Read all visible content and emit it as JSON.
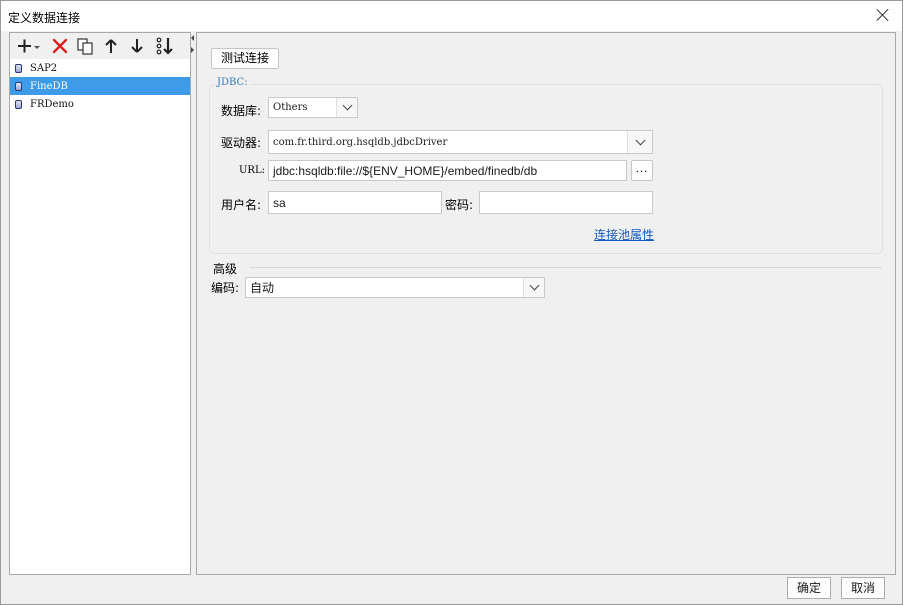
{
  "window": {
    "title": "定义数据连接"
  },
  "toolbar": {
    "add_icon": "plus-with-dropdown-icon",
    "delete_icon": "red-x-icon",
    "copy_icon": "copy-icon",
    "move_up_icon": "arrow-up-icon",
    "move_down_icon": "arrow-down-icon",
    "sort_icon": "sort-icon"
  },
  "connections": [
    {
      "label": "SAP2",
      "selected": false
    },
    {
      "label": "FineDB",
      "selected": true
    },
    {
      "label": "FRDemo",
      "selected": false
    }
  ],
  "detail": {
    "test_button": "测试连接",
    "group_title": "JDBC:",
    "database_label": "数据库:",
    "database_value": "Others",
    "driver_label": "驱动器:",
    "driver_value": "com.fr.third.org.hsqldb.jdbcDriver",
    "url_label": "URL:",
    "url_value": "jdbc:hsqldb:file://${ENV_HOME}/embed/finedb/db",
    "url_browse": "...",
    "username_label": "用户名:",
    "username_value": "sa",
    "password_label": "密码:",
    "password_value": "",
    "pool_link": "连接池属性",
    "advanced_title": "高级",
    "encoding_label": "编码:",
    "encoding_value": "自动"
  },
  "footer": {
    "ok": "确定",
    "cancel": "取消"
  },
  "colors": {
    "selection": "#3d9be9",
    "link": "#1358c8",
    "legend": "#2f7bbf",
    "delete": "#e02020"
  }
}
